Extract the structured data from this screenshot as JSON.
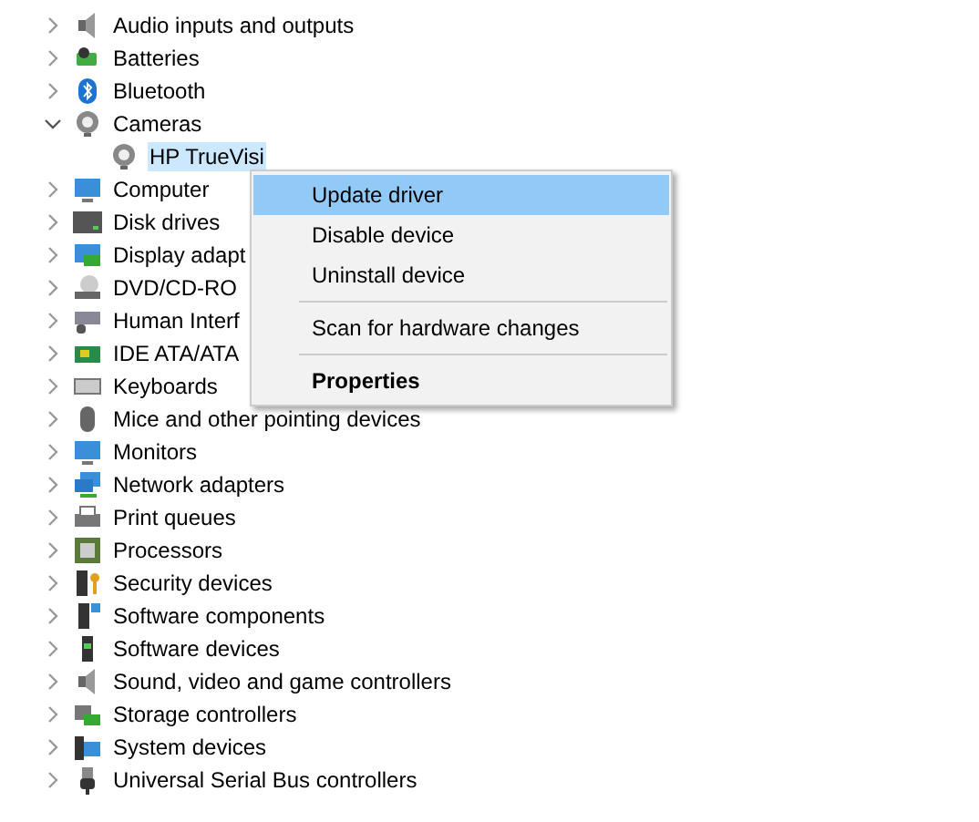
{
  "tree": [
    {
      "label": "Audio inputs and outputs",
      "expanded": false
    },
    {
      "label": "Batteries",
      "expanded": false
    },
    {
      "label": "Bluetooth",
      "expanded": false
    },
    {
      "label": "Cameras",
      "expanded": true,
      "children": [
        {
          "label": "HP TrueVisi",
          "selected": true
        }
      ]
    },
    {
      "label": "Computer",
      "expanded": false
    },
    {
      "label": "Disk drives",
      "expanded": false
    },
    {
      "label": "Display adapt",
      "expanded": false
    },
    {
      "label": "DVD/CD-RO",
      "expanded": false
    },
    {
      "label": "Human Interf",
      "expanded": false
    },
    {
      "label": "IDE ATA/ATA",
      "expanded": false
    },
    {
      "label": "Keyboards",
      "expanded": false
    },
    {
      "label": "Mice and other pointing devices",
      "expanded": false
    },
    {
      "label": "Monitors",
      "expanded": false
    },
    {
      "label": "Network adapters",
      "expanded": false
    },
    {
      "label": "Print queues",
      "expanded": false
    },
    {
      "label": "Processors",
      "expanded": false
    },
    {
      "label": "Security devices",
      "expanded": false
    },
    {
      "label": "Software components",
      "expanded": false
    },
    {
      "label": "Software devices",
      "expanded": false
    },
    {
      "label": "Sound, video and game controllers",
      "expanded": false
    },
    {
      "label": "Storage controllers",
      "expanded": false
    },
    {
      "label": "System devices",
      "expanded": false
    },
    {
      "label": "Universal Serial Bus controllers",
      "expanded": false
    }
  ],
  "context_menu": [
    {
      "kind": "item",
      "label": "Update driver",
      "selected": true,
      "bold": false
    },
    {
      "kind": "item",
      "label": "Disable device",
      "selected": false,
      "bold": false
    },
    {
      "kind": "item",
      "label": "Uninstall device",
      "selected": false,
      "bold": false
    },
    {
      "kind": "separator"
    },
    {
      "kind": "item",
      "label": "Scan for hardware changes",
      "selected": false,
      "bold": false
    },
    {
      "kind": "separator"
    },
    {
      "kind": "item",
      "label": "Properties",
      "selected": false,
      "bold": true
    }
  ]
}
